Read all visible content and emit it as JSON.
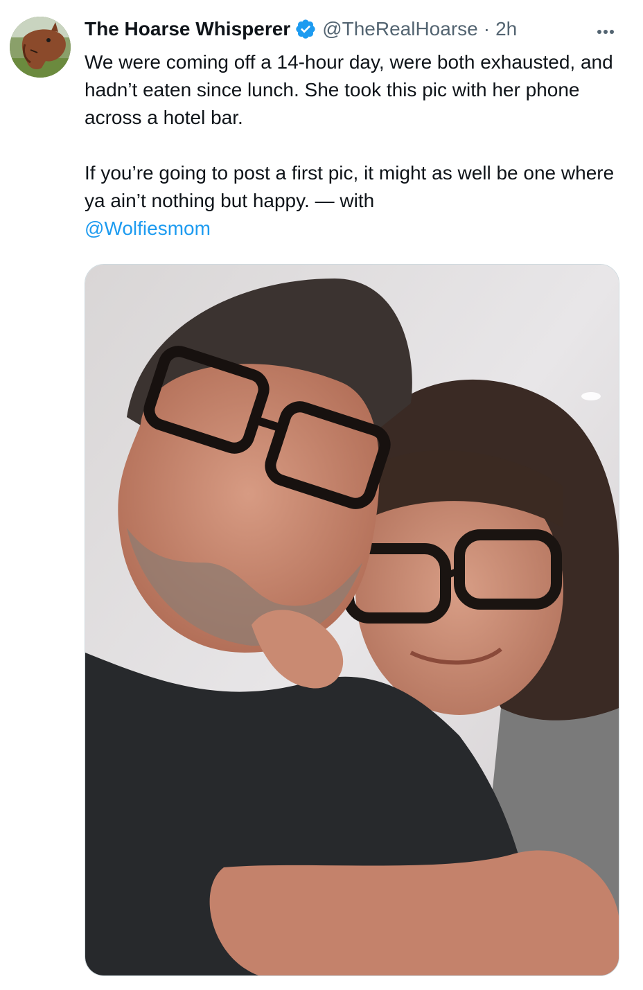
{
  "author": {
    "display_name": "The Hoarse Whisperer",
    "handle": "@TheRealHoarse",
    "separator": "·",
    "time": "2h",
    "avatar_icon": "horse-head-avatar",
    "verified_icon": "verified-badge-icon"
  },
  "tweet": {
    "paragraph_1": "We were coming off a 14-hour day, were both exhausted, and hadn’t eaten since lunch. She took this pic with her phone across a hotel bar.",
    "paragraph_2_text": "If you’re going to post a first pic, it might as well be one where ya ain’t nothing but happy. — with",
    "mention": "@Wolfiesmom"
  },
  "media": {
    "alt": "Selfie of a man and a woman wearing glasses embracing"
  },
  "colors": {
    "link": "#1d9bf0",
    "verified": "#1d9bf0",
    "secondary_text": "#536471",
    "primary_text": "#0f1419"
  }
}
